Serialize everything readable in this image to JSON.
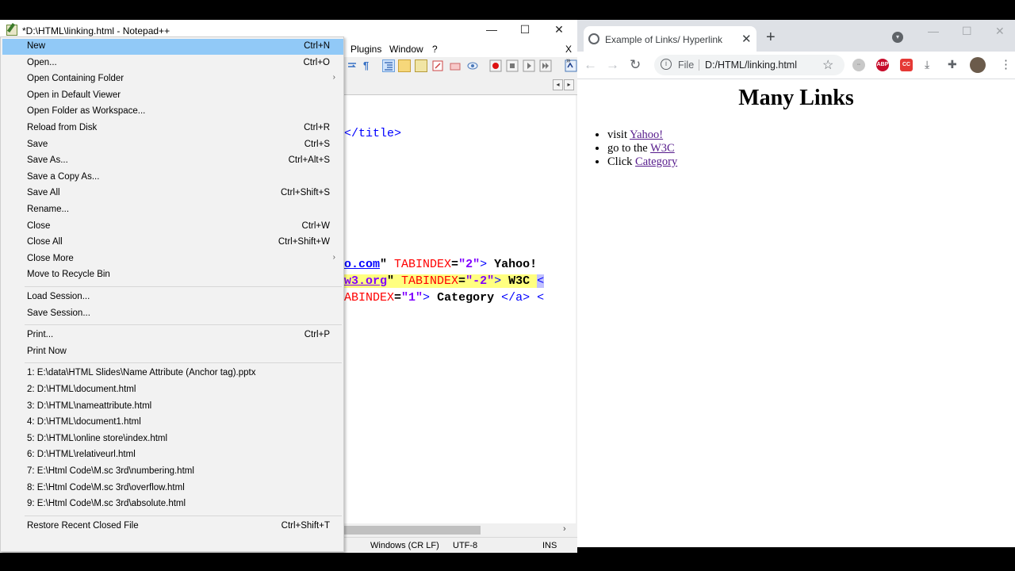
{
  "notepad": {
    "title": "*D:\\HTML\\linking.html - Notepad++",
    "window_buttons": [
      "—",
      "☐",
      "✕"
    ],
    "menu": {
      "plugins": "Plugins",
      "window": "Window",
      "help": "?",
      "close_x": "X"
    },
    "code_lines": [
      {
        "parts": [
          {
            "t": "</title>",
            "c": "tag"
          }
        ]
      },
      {
        "parts": [
          {
            "t": "o.com",
            "c": "str"
          },
          {
            "t": "\" ",
            "c": "txt"
          },
          {
            "t": "TABINDEX",
            "c": "attr"
          },
          {
            "t": "=",
            "c": "txt"
          },
          {
            "t": "\"2\"",
            "c": "str"
          },
          {
            "t": "> ",
            "c": "tag"
          },
          {
            "t": "Yahoo!",
            "c": "txt"
          }
        ]
      },
      {
        "parts": [
          {
            "t": "w3.org",
            "c": "str"
          },
          {
            "t": "\" ",
            "c": "txt"
          },
          {
            "t": "TABINDEX",
            "c": "attr"
          },
          {
            "t": "=",
            "c": "txt"
          },
          {
            "t": "\"-2\"",
            "c": "str"
          },
          {
            "t": "> ",
            "c": "tag"
          },
          {
            "t": "W3C ",
            "c": "txt"
          },
          {
            "t": "<",
            "c": "tag"
          }
        ]
      },
      {
        "parts": [
          {
            "t": "ABINDEX",
            "c": "attr"
          },
          {
            "t": "=",
            "c": "txt"
          },
          {
            "t": "\"1\"",
            "c": "str"
          },
          {
            "t": "> ",
            "c": "tag"
          },
          {
            "t": "Category ",
            "c": "txt"
          },
          {
            "t": "</a> <",
            "c": "tag"
          }
        ]
      }
    ],
    "status": {
      "eol": "Windows (CR LF)",
      "encoding": "UTF-8",
      "mode": "INS"
    }
  },
  "file_menu": {
    "items": [
      {
        "label": "New",
        "shortcut": "Ctrl+N",
        "highlighted": true
      },
      {
        "label": "Open...",
        "shortcut": "Ctrl+O"
      },
      {
        "label": "Open Containing Folder",
        "submenu": true
      },
      {
        "label": "Open in Default Viewer"
      },
      {
        "label": "Open Folder as Workspace..."
      },
      {
        "label": "Reload from Disk",
        "shortcut": "Ctrl+R"
      },
      {
        "label": "Save",
        "shortcut": "Ctrl+S"
      },
      {
        "label": "Save As...",
        "shortcut": "Ctrl+Alt+S"
      },
      {
        "label": "Save a Copy As..."
      },
      {
        "label": "Save All",
        "shortcut": "Ctrl+Shift+S"
      },
      {
        "label": "Rename..."
      },
      {
        "label": "Close",
        "shortcut": "Ctrl+W"
      },
      {
        "label": "Close All",
        "shortcut": "Ctrl+Shift+W"
      },
      {
        "label": "Close More",
        "submenu": true
      },
      {
        "label": "Move to Recycle Bin"
      },
      {
        "separator": true
      },
      {
        "label": "Load Session..."
      },
      {
        "label": "Save Session..."
      },
      {
        "separator": true
      },
      {
        "label": "Print...",
        "shortcut": "Ctrl+P"
      },
      {
        "label": "Print Now"
      },
      {
        "separator": true
      },
      {
        "label": "1: E:\\data\\HTML Slides\\Name Attribute (Anchor tag).pptx"
      },
      {
        "label": "2: D:\\HTML\\document.html"
      },
      {
        "label": "3: D:\\HTML\\nameattribute.html"
      },
      {
        "label": "4: D:\\HTML\\document1.html"
      },
      {
        "label": "5: D:\\HTML\\online store\\index.html"
      },
      {
        "label": "6: D:\\HTML\\relativeurl.html"
      },
      {
        "label": "7: E:\\Html Code\\M.sc 3rd\\numbering.html"
      },
      {
        "label": "8: E:\\Html Code\\M.sc 3rd\\overflow.html"
      },
      {
        "label": "9: E:\\Html Code\\M.sc 3rd\\absolute.html"
      },
      {
        "separator": true
      },
      {
        "label": "Restore Recent Closed File",
        "shortcut": "Ctrl+Shift+T"
      }
    ]
  },
  "chrome": {
    "tab_title": "Example of Links/ Hyperlink",
    "omnibox_scheme": "File",
    "omnibox_url": "D:/HTML/linking.html",
    "page": {
      "heading": "Many Links",
      "items": [
        {
          "prefix": "visit ",
          "link": "Yahoo!"
        },
        {
          "prefix": "go to the ",
          "link": "W3C"
        },
        {
          "prefix": "Click ",
          "link": "Category"
        }
      ]
    },
    "extensions": [
      {
        "name": "abp-icon",
        "label": "ABP",
        "color": "#c70d2c"
      },
      {
        "name": "cc-icon",
        "label": "CC",
        "color": "#e53935"
      }
    ]
  }
}
